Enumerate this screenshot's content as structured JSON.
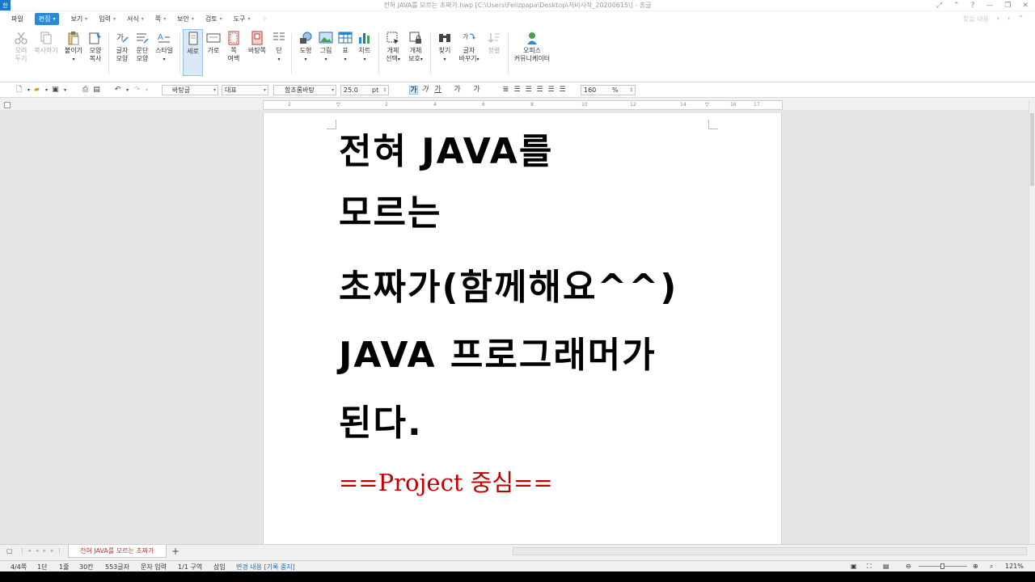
{
  "window": {
    "app_icon": "한",
    "title": "전혀 JAVA를 모르는 초짜가.hwp [C:\\Users\\Felizpapa\\Desktop\\저비사작_20200615\\] - 혼글"
  },
  "menu": {
    "items": [
      {
        "label": "파일",
        "arrow": false
      },
      {
        "label": "편집",
        "arrow": true,
        "active": true
      },
      {
        "label": "보기",
        "arrow": true
      },
      {
        "label": "입력",
        "arrow": true
      },
      {
        "label": "서식",
        "arrow": true
      },
      {
        "label": "쪽",
        "arrow": true
      },
      {
        "label": "보안",
        "arrow": true
      },
      {
        "label": "검토",
        "arrow": true
      },
      {
        "label": "도구",
        "arrow": true
      }
    ],
    "right_search": "찾을 내용"
  },
  "ribbon": {
    "cut": "오려\n두기",
    "copy": "복사하기",
    "paste": "붙이기",
    "format_copy": "모양\n복사",
    "char_shape": "글자\n모양",
    "para_shape": "문단\n모양",
    "style": "스타일",
    "vertical": "세로",
    "horizontal": "가로",
    "margin": "쪽\n여백",
    "background": "바탕쪽",
    "columns": "단",
    "shape": "도형",
    "picture": "그림",
    "table": "표",
    "chart": "차트",
    "obj_select": "개체\n선택",
    "obj_protect": "개체\n보호",
    "find": "찾기",
    "replace": "글자\n바꾸기",
    "arrange": "정렬",
    "office": "오피스\n커뮤니케이터"
  },
  "toolbar": {
    "style_name": "바탕글",
    "lang": "대표",
    "font": "함초롬바탕",
    "size": "25.0",
    "unit": "pt",
    "zoom": "160",
    "zoom_unit": "%"
  },
  "document": {
    "lines": [
      "전혀 JAVA를",
      "모르는",
      "초짜가(함께해요^^)",
      "JAVA 프로그래머가",
      "된다."
    ],
    "subtitle": "==Project 중심=="
  },
  "tabs": {
    "doc_tab": "전혀 JAVA를 모르는 초짜가",
    "add": "+"
  },
  "status": {
    "page": "4/4쪽",
    "section": "1단",
    "line": "1줄",
    "column": "30칸",
    "chars": "553글자",
    "input_mode": "문자 입력",
    "area": "1/1 구역",
    "insert": "삽입",
    "track": "변경 내용 [기록 중지]",
    "zoom": "121%"
  },
  "colors": {
    "accent": "#2b89d6",
    "subtitle": "#c00000"
  }
}
